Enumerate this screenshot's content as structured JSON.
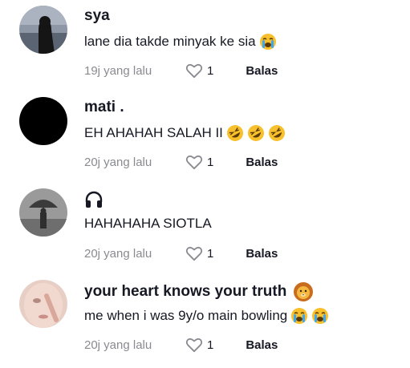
{
  "comments": [
    {
      "username": "sya",
      "text": "lane dia takde minyak ke sia",
      "text_emojis": [
        "loudly-crying-face"
      ],
      "time": "19j yang lalu",
      "likes": "1",
      "reply_label": "Balas"
    },
    {
      "username": "mati .",
      "text": "EH AHAHAH SALAH II",
      "text_emojis": [
        "rolling-laughing-face",
        "rolling-laughing-face",
        "rolling-laughing-face"
      ],
      "time": "20j yang lalu",
      "likes": "1",
      "reply_label": "Balas"
    },
    {
      "username": "",
      "username_icon": "headphone-icon",
      "text": "HAHAHAHA SIOTLA",
      "time": "20j yang lalu",
      "likes": "1",
      "reply_label": "Balas"
    },
    {
      "username": "your heart knows your truth",
      "username_emoji": "lion-face",
      "text": "me when i was 9y/o main bowling",
      "text_emojis": [
        "loudly-crying-face",
        "loudly-crying-face"
      ],
      "time": "20j yang lalu",
      "likes": "1",
      "reply_label": "Balas"
    }
  ],
  "colors": {
    "text": "#161823",
    "meta": "#8a8b91",
    "emoji_yellow": "#f7c02c",
    "tear_blue": "#3aa6f5"
  }
}
